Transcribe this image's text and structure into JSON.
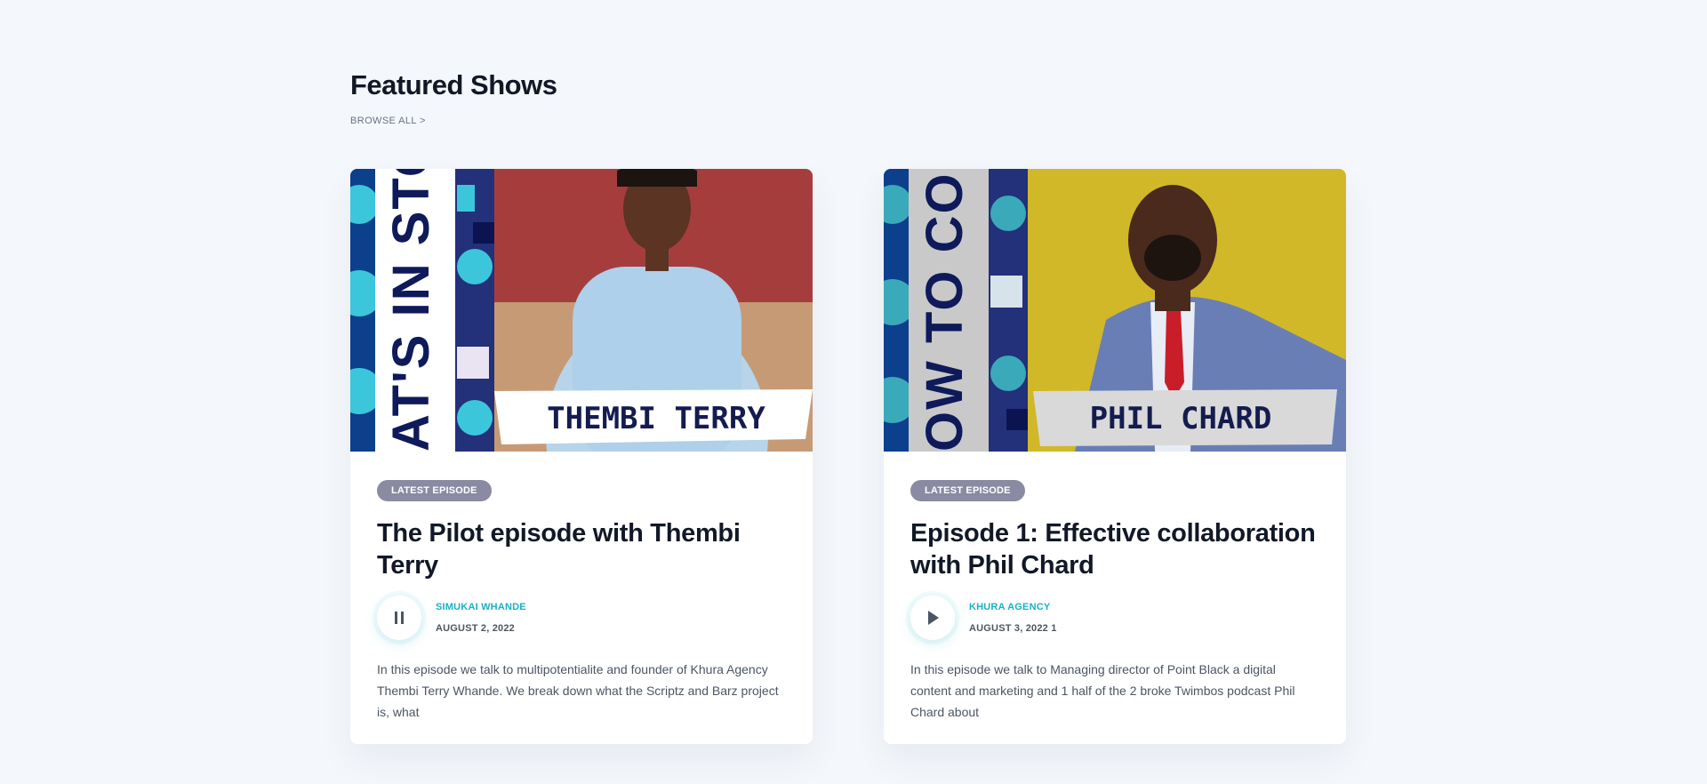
{
  "section": {
    "title": "Featured Shows",
    "browse_label": "BROWSE ALL >"
  },
  "cards": [
    {
      "cover_banner": "AT'S IN STO",
      "cover_name": "THEMBI TERRY",
      "badge": "LATEST EPISODE",
      "title": "The Pilot episode with Thembi Terry",
      "player_state": "pause-icon",
      "author": "SIMUKAI WHANDE",
      "date": "AUGUST 2, 2022",
      "description": "In this episode we talk to multipotentialite and founder of Khura Agency Thembi Terry Whande. We break down what the Scriptz and Barz project is, what"
    },
    {
      "cover_banner": "OW TO COLL",
      "cover_name": "PHIL CHARD",
      "badge": "LATEST EPISODE",
      "title": "Episode 1: Effective collaboration with Phil Chard",
      "player_state": "play-icon",
      "author": "KHURA AGENCY",
      "date": "AUGUST 3, 2022 1",
      "description": "In this episode we talk to Managing director of Point Black a digital content and marketing and 1 half of the 2 broke Twimbos podcast Phil Chard about"
    }
  ],
  "colors": {
    "background": "#f4f7fb",
    "accent": "#19b1c7",
    "badge": "#8a8aa3",
    "cover_navy": "#1f2a6b",
    "cover_yellow": "#d1b829"
  }
}
